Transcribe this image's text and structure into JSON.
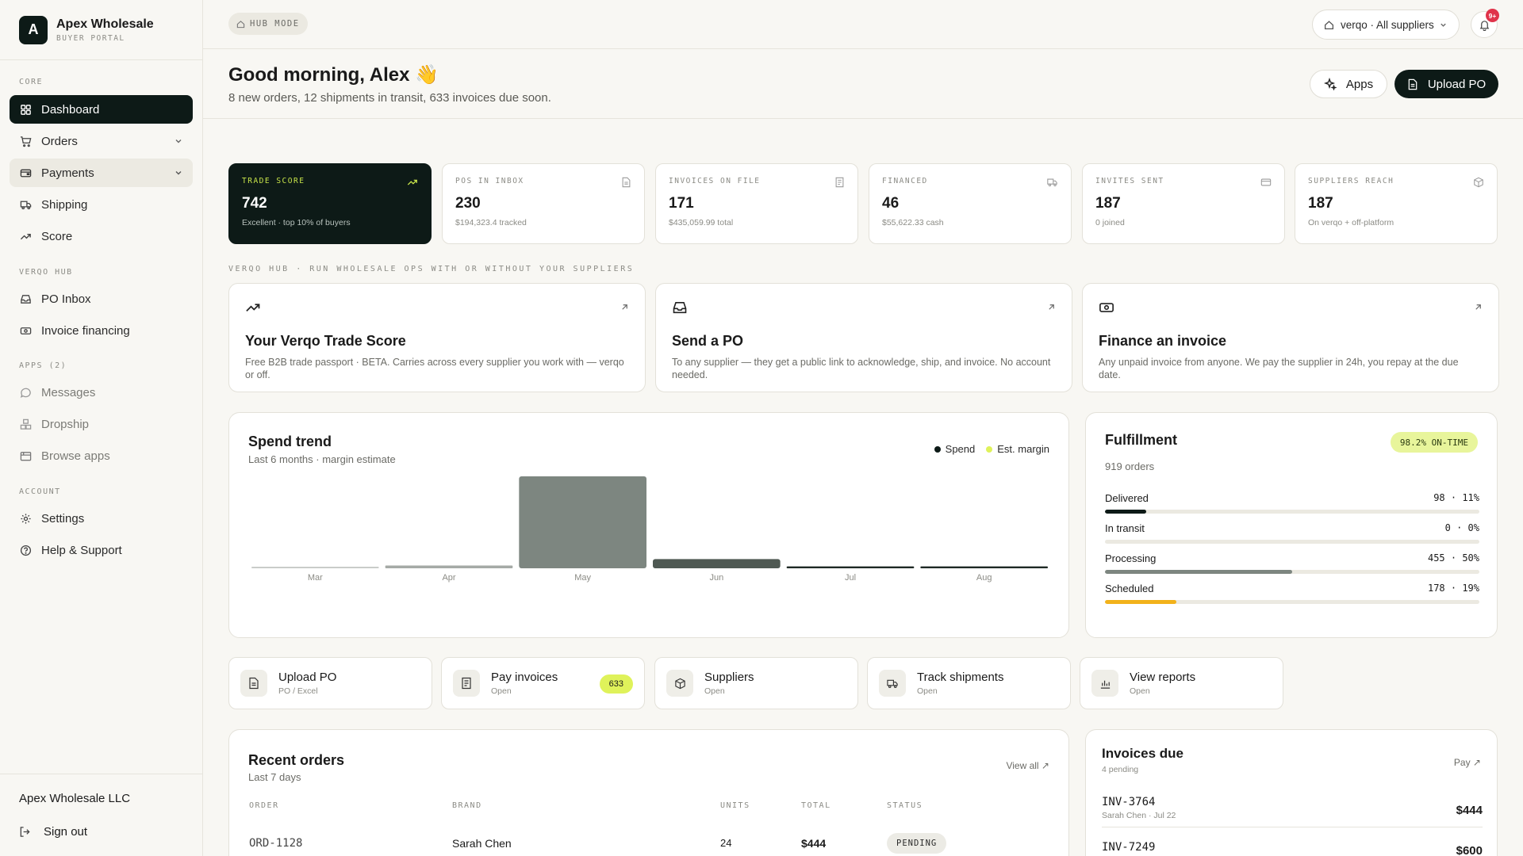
{
  "brand": {
    "initial": "A",
    "name": "Apex Wholesale",
    "subtitle": "BUYER PORTAL"
  },
  "sidebar": {
    "sections": {
      "core": "CORE",
      "hub": "VERQO HUB",
      "apps": "APPS  (2)",
      "account": "ACCOUNT"
    },
    "items": [
      {
        "label": "Dashboard",
        "icon": "grid-icon"
      },
      {
        "label": "Orders",
        "icon": "cart-icon"
      },
      {
        "label": "Payments",
        "icon": "wallet-icon"
      },
      {
        "label": "Shipping",
        "icon": "truck-icon"
      },
      {
        "label": "Score",
        "icon": "trending-up-icon"
      },
      {
        "label": "PO Inbox",
        "icon": "inbox-icon"
      },
      {
        "label": "Invoice financing",
        "icon": "cash-icon"
      },
      {
        "label": "Messages",
        "icon": "message-icon"
      },
      {
        "label": "Dropship",
        "icon": "boxes-icon"
      },
      {
        "label": "Browse apps",
        "icon": "store-icon"
      },
      {
        "label": "Settings",
        "icon": "gear-icon"
      },
      {
        "label": "Help & Support",
        "icon": "help-icon"
      }
    ],
    "footer": {
      "company": "Apex Wholesale LLC",
      "signout": "Sign out"
    }
  },
  "topbar": {
    "mode": "HUB MODE",
    "supplier_select": "verqo · All suppliers",
    "notification_count": "9+"
  },
  "header": {
    "greeting": "Good morning, Alex 👋",
    "summary": "8 new orders, 12 shipments in transit, 633 invoices due soon.",
    "apps_label": "Apps",
    "upload_label": "Upload PO"
  },
  "stats": [
    {
      "label": "TRADE SCORE",
      "value": "742",
      "sub": "Excellent · top 10% of buyers"
    },
    {
      "label": "POS IN INBOX",
      "value": "230",
      "sub": "$194,323.4 tracked"
    },
    {
      "label": "INVOICES ON FILE",
      "value": "171",
      "sub": "$435,059.99 total"
    },
    {
      "label": "FINANCED",
      "value": "46",
      "sub": "$55,622.33 cash"
    },
    {
      "label": "INVITES SENT",
      "value": "187",
      "sub": "0 joined"
    },
    {
      "label": "SUPPLIERS REACH",
      "value": "187",
      "sub": "On verqo + off-platform"
    }
  ],
  "hub_caption": "VERQO HUB · RUN WHOLESALE OPS WITH OR WITHOUT YOUR SUPPLIERS",
  "features": [
    {
      "title": "Your Verqo Trade Score",
      "desc": "Free B2B trade passport · BETA. Carries across every supplier you work with — verqo or off."
    },
    {
      "title": "Send a PO",
      "desc": "To any supplier — they get a public link to acknowledge, ship, and invoice. No account needed."
    },
    {
      "title": "Finance an invoice",
      "desc": "Any unpaid invoice from anyone. We pay the supplier in 24h, you repay at the due date."
    }
  ],
  "spend": {
    "title": "Spend trend",
    "subtitle": "Last 6 months · margin estimate",
    "legend_spend": "Spend",
    "legend_margin": "Est. margin"
  },
  "chart_data": {
    "type": "bar",
    "categories": [
      "Mar",
      "Apr",
      "May",
      "Jun",
      "Jul",
      "Aug"
    ],
    "series": [
      {
        "name": "Spend",
        "values": [
          1,
          3,
          100,
          10,
          2,
          2
        ]
      }
    ],
    "ylim": [
      0,
      100
    ],
    "colors": [
      "#c9ccc9",
      "#a5aaa6",
      "#7d8680",
      "#4f5953",
      "#1f2a25",
      "#1f2a25"
    ]
  },
  "fulfillment": {
    "title": "Fulfillment",
    "badge": "98.2% ON-TIME",
    "count": "919 orders",
    "rows": [
      {
        "label": "Delivered",
        "value": "98  ·  11%",
        "pct": 11,
        "color": "#0d1a17"
      },
      {
        "label": "In transit",
        "value": "0  ·  0%",
        "pct": 0,
        "color": "#0d1a17"
      },
      {
        "label": "Processing",
        "value": "455  ·  50%",
        "pct": 50,
        "color": "#7d8680"
      },
      {
        "label": "Scheduled",
        "value": "178  ·  19%",
        "pct": 19,
        "color": "#f2b21b"
      }
    ]
  },
  "quick_actions": [
    {
      "title": "Upload PO",
      "sub": "PO / Excel",
      "icon": "file-icon"
    },
    {
      "title": "Pay invoices",
      "sub": "Open",
      "icon": "receipt-icon",
      "badge": "633"
    },
    {
      "title": "Suppliers",
      "sub": "Open",
      "icon": "package-icon"
    },
    {
      "title": "Track shipments",
      "sub": "Open",
      "icon": "truck-icon"
    },
    {
      "title": "View reports",
      "sub": "Open",
      "icon": "bar-chart-icon"
    }
  ],
  "orders": {
    "title": "Recent orders",
    "subtitle": "Last 7 days",
    "view_all": "View all ↗",
    "columns": [
      "ORDER",
      "BRAND",
      "UNITS",
      "TOTAL",
      "STATUS"
    ],
    "rows": [
      {
        "order": "ORD-1128",
        "brand": "Sarah Chen",
        "units": "24",
        "total": "$444",
        "status": "PENDING"
      }
    ]
  },
  "invoices": {
    "title": "Invoices due",
    "subtitle": "4 pending",
    "pay_link": "Pay ↗",
    "rows": [
      {
        "id": "INV-3764",
        "meta": "Sarah Chen · Jul 22",
        "amount": "$444"
      },
      {
        "id": "INV-7249",
        "meta": "",
        "amount": "$600"
      }
    ]
  }
}
